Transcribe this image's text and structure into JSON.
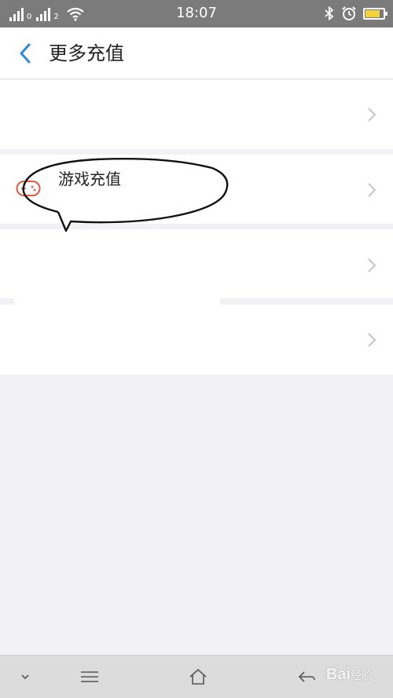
{
  "status_bar": {
    "time": "18:07",
    "sim1_label": "0",
    "sim2_label": "2",
    "icons": [
      "signal-icon",
      "signal-icon",
      "wifi-icon",
      "bluetooth-icon",
      "alarm-icon",
      "battery-icon"
    ],
    "battery_color": "#f3d23a"
  },
  "header": {
    "title": "更多充值",
    "back_icon": "chevron-left-icon",
    "accent_color": "#2b8be0"
  },
  "list": {
    "items": [
      {
        "title": "",
        "subtitle": ""
      },
      {
        "title": "游戏充值",
        "subtitle": "",
        "icon": "gamepad-icon",
        "icon_color": "#e8573f"
      },
      {
        "title": "",
        "subtitle": ""
      },
      {
        "title": "",
        "subtitle": ""
      }
    ]
  },
  "nav_bar": {
    "icons": [
      "chevron-down-icon",
      "menu-icon",
      "home-icon",
      "back-icon"
    ]
  },
  "watermark": {
    "brand": "Bai",
    "suffix": "经验"
  }
}
